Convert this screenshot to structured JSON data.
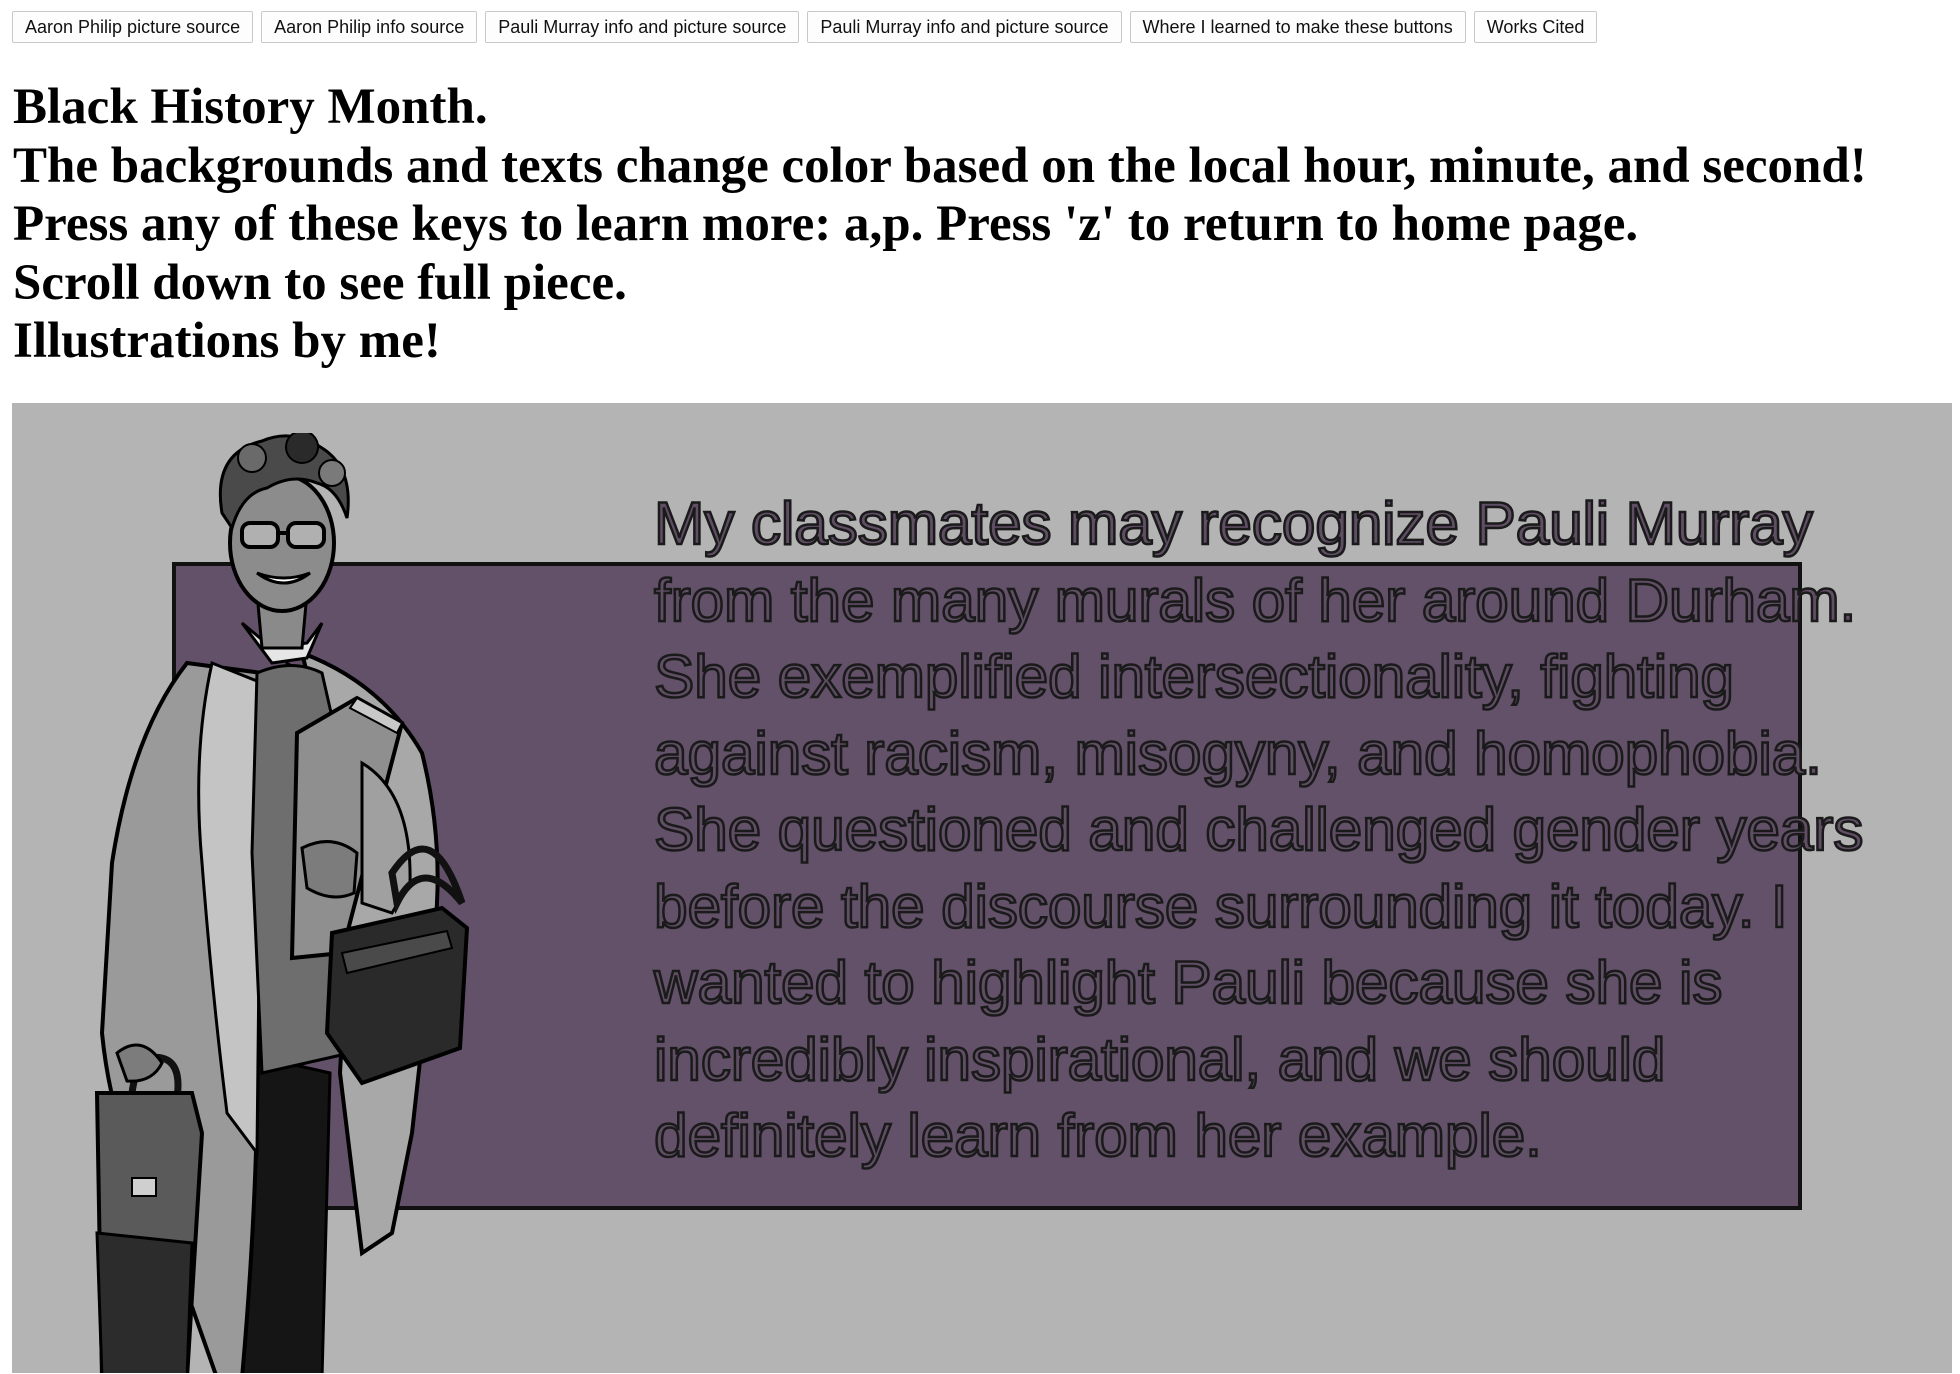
{
  "buttons": [
    {
      "label": "Aaron Philip picture source"
    },
    {
      "label": "Aaron Philip info source"
    },
    {
      "label": "Pauli Murray info and picture source"
    },
    {
      "label": "Pauli Murray info and picture source"
    },
    {
      "label": "Where I learned to make these buttons"
    },
    {
      "label": "Works Cited"
    }
  ],
  "headings": [
    "Black History Month.",
    "The backgrounds and texts change color based on the local hour, minute, and second!",
    "Press any of these keys to learn more: a,p. Press 'z' to return to home page.",
    "Scroll down to see full piece.",
    "Illustrations by me!"
  ],
  "artwork": {
    "quote_lines": [
      "My classmates may recognize Pauli Murray",
      "from the many murals of her around Durham.",
      "She exemplified intersectionality, fighting",
      "against racism, misogyny, and homophobia.",
      "She questioned and challenged gender years",
      "before the discourse surrounding it today. I",
      "wanted to highlight Pauli because she is",
      "incredibly inspirational, and we should",
      "definitely learn from her example."
    ],
    "colors": {
      "canvas_bg": "#b4b4b4",
      "panel_fill": "#625168",
      "panel_border": "#111111",
      "text_fill": "#5f4e64",
      "text_stroke": "#1a1a1a"
    },
    "figure_icon": "pauli-murray-illustration"
  }
}
